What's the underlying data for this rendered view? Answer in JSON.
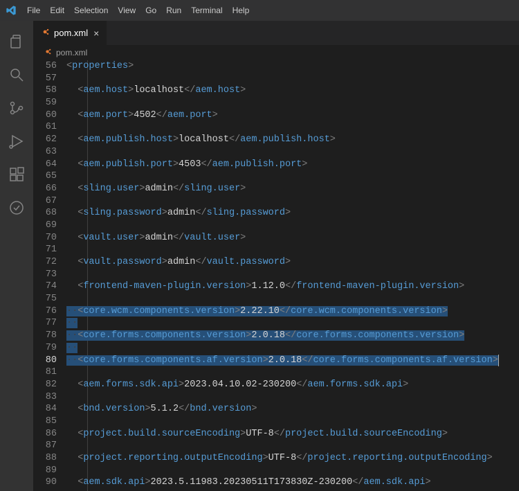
{
  "menu": [
    "File",
    "Edit",
    "Selection",
    "View",
    "Go",
    "Run",
    "Terminal",
    "Help"
  ],
  "tab": {
    "icon": "xml-icon",
    "label": "pom.xml"
  },
  "breadcrumb": {
    "icon": "xml-icon",
    "label": "pom.xml"
  },
  "first_line_no": 56,
  "active_line_no": 80,
  "highlighted_line_nos": [
    76,
    77,
    78,
    79,
    80
  ],
  "ws_glyph": "·",
  "lines": [
    {
      "indent": 0,
      "segs": [
        [
          "punc",
          "<"
        ],
        [
          "tag",
          "properties"
        ],
        [
          "punc",
          ">"
        ]
      ]
    },
    {
      "indent": 0,
      "segs": []
    },
    {
      "indent": 1,
      "segs": [
        [
          "punc",
          "<"
        ],
        [
          "tag",
          "aem.host"
        ],
        [
          "punc",
          ">"
        ],
        [
          "text",
          "localhost"
        ],
        [
          "punc",
          "</"
        ],
        [
          "tag",
          "aem.host"
        ],
        [
          "punc",
          ">"
        ]
      ]
    },
    {
      "indent": 1,
      "segs": []
    },
    {
      "indent": 1,
      "segs": [
        [
          "punc",
          "<"
        ],
        [
          "tag",
          "aem.port"
        ],
        [
          "punc",
          ">"
        ],
        [
          "text",
          "4502"
        ],
        [
          "punc",
          "</"
        ],
        [
          "tag",
          "aem.port"
        ],
        [
          "punc",
          ">"
        ]
      ]
    },
    {
      "indent": 1,
      "segs": []
    },
    {
      "indent": 1,
      "segs": [
        [
          "punc",
          "<"
        ],
        [
          "tag",
          "aem.publish.host"
        ],
        [
          "punc",
          ">"
        ],
        [
          "text",
          "localhost"
        ],
        [
          "punc",
          "</"
        ],
        [
          "tag",
          "aem.publish.host"
        ],
        [
          "punc",
          ">"
        ]
      ]
    },
    {
      "indent": 1,
      "segs": []
    },
    {
      "indent": 1,
      "segs": [
        [
          "punc",
          "<"
        ],
        [
          "tag",
          "aem.publish.port"
        ],
        [
          "punc",
          ">"
        ],
        [
          "text",
          "4503"
        ],
        [
          "punc",
          "</"
        ],
        [
          "tag",
          "aem.publish.port"
        ],
        [
          "punc",
          ">"
        ]
      ]
    },
    {
      "indent": 1,
      "segs": []
    },
    {
      "indent": 1,
      "segs": [
        [
          "punc",
          "<"
        ],
        [
          "tag",
          "sling.user"
        ],
        [
          "punc",
          ">"
        ],
        [
          "text",
          "admin"
        ],
        [
          "punc",
          "</"
        ],
        [
          "tag",
          "sling.user"
        ],
        [
          "punc",
          ">"
        ]
      ]
    },
    {
      "indent": 1,
      "segs": []
    },
    {
      "indent": 1,
      "segs": [
        [
          "punc",
          "<"
        ],
        [
          "tag",
          "sling.password"
        ],
        [
          "punc",
          ">"
        ],
        [
          "text",
          "admin"
        ],
        [
          "punc",
          "</"
        ],
        [
          "tag",
          "sling.password"
        ],
        [
          "punc",
          ">"
        ]
      ]
    },
    {
      "indent": 1,
      "segs": []
    },
    {
      "indent": 1,
      "segs": [
        [
          "punc",
          "<"
        ],
        [
          "tag",
          "vault.user"
        ],
        [
          "punc",
          ">"
        ],
        [
          "text",
          "admin"
        ],
        [
          "punc",
          "</"
        ],
        [
          "tag",
          "vault.user"
        ],
        [
          "punc",
          ">"
        ]
      ]
    },
    {
      "indent": 1,
      "segs": []
    },
    {
      "indent": 1,
      "segs": [
        [
          "punc",
          "<"
        ],
        [
          "tag",
          "vault.password"
        ],
        [
          "punc",
          ">"
        ],
        [
          "text",
          "admin"
        ],
        [
          "punc",
          "</"
        ],
        [
          "tag",
          "vault.password"
        ],
        [
          "punc",
          ">"
        ]
      ]
    },
    {
      "indent": 1,
      "segs": []
    },
    {
      "indent": 1,
      "segs": [
        [
          "punc",
          "<"
        ],
        [
          "tag",
          "frontend-maven-plugin.version"
        ],
        [
          "punc",
          ">"
        ],
        [
          "text",
          "1.12.0"
        ],
        [
          "punc",
          "</"
        ],
        [
          "tag",
          "frontend-maven-plugin.version"
        ],
        [
          "punc",
          ">"
        ]
      ]
    },
    {
      "indent": 1,
      "segs": []
    },
    {
      "indent": 1,
      "segs": [
        [
          "punc",
          "<"
        ],
        [
          "tag",
          "core.wcm.components.version"
        ],
        [
          "punc",
          ">"
        ],
        [
          "text",
          "2.22.10"
        ],
        [
          "punc",
          "</"
        ],
        [
          "tag",
          "core.wcm.components.version"
        ],
        [
          "punc",
          ">"
        ]
      ]
    },
    {
      "indent": 1,
      "segs": []
    },
    {
      "indent": 1,
      "segs": [
        [
          "punc",
          "<"
        ],
        [
          "tag",
          "core.forms.components.version"
        ],
        [
          "punc",
          ">"
        ],
        [
          "text",
          "2.0.18"
        ],
        [
          "punc",
          "</"
        ],
        [
          "tag",
          "core.forms.components.version"
        ],
        [
          "punc",
          ">"
        ]
      ]
    },
    {
      "indent": 1,
      "segs": []
    },
    {
      "indent": 1,
      "segs": [
        [
          "punc",
          "<"
        ],
        [
          "tag",
          "core.forms.components.af.version"
        ],
        [
          "punc",
          ">"
        ],
        [
          "text",
          "2.0.18"
        ],
        [
          "punc",
          "</"
        ],
        [
          "tag",
          "core.forms.components.af.version"
        ],
        [
          "punc",
          ">"
        ]
      ]
    },
    {
      "indent": 1,
      "segs": []
    },
    {
      "indent": 1,
      "segs": [
        [
          "punc",
          "<"
        ],
        [
          "tag",
          "aem.forms.sdk.api"
        ],
        [
          "punc",
          ">"
        ],
        [
          "text",
          "2023.04.10.02-230200"
        ],
        [
          "punc",
          "</"
        ],
        [
          "tag",
          "aem.forms.sdk.api"
        ],
        [
          "punc",
          ">"
        ]
      ]
    },
    {
      "indent": 1,
      "segs": []
    },
    {
      "indent": 1,
      "segs": [
        [
          "punc",
          "<"
        ],
        [
          "tag",
          "bnd.version"
        ],
        [
          "punc",
          ">"
        ],
        [
          "text",
          "5.1.2"
        ],
        [
          "punc",
          "</"
        ],
        [
          "tag",
          "bnd.version"
        ],
        [
          "punc",
          ">"
        ]
      ]
    },
    {
      "indent": 1,
      "segs": []
    },
    {
      "indent": 1,
      "segs": [
        [
          "punc",
          "<"
        ],
        [
          "tag",
          "project.build.sourceEncoding"
        ],
        [
          "punc",
          ">"
        ],
        [
          "text",
          "UTF-8"
        ],
        [
          "punc",
          "</"
        ],
        [
          "tag",
          "project.build.sourceEncoding"
        ],
        [
          "punc",
          ">"
        ]
      ]
    },
    {
      "indent": 1,
      "segs": []
    },
    {
      "indent": 1,
      "segs": [
        [
          "punc",
          "<"
        ],
        [
          "tag",
          "project.reporting.outputEncoding"
        ],
        [
          "punc",
          ">"
        ],
        [
          "text",
          "UTF-8"
        ],
        [
          "punc",
          "</"
        ],
        [
          "tag",
          "project.reporting.outputEncoding"
        ],
        [
          "punc",
          ">"
        ]
      ]
    },
    {
      "indent": 1,
      "segs": []
    },
    {
      "indent": 1,
      "segs": [
        [
          "punc",
          "<"
        ],
        [
          "tag",
          "aem.sdk.api"
        ],
        [
          "punc",
          ">"
        ],
        [
          "text",
          "2023.5.11983.20230511T173830Z-230200"
        ],
        [
          "punc",
          "</"
        ],
        [
          "tag",
          "aem.sdk.api"
        ],
        [
          "punc",
          ">"
        ]
      ]
    }
  ]
}
